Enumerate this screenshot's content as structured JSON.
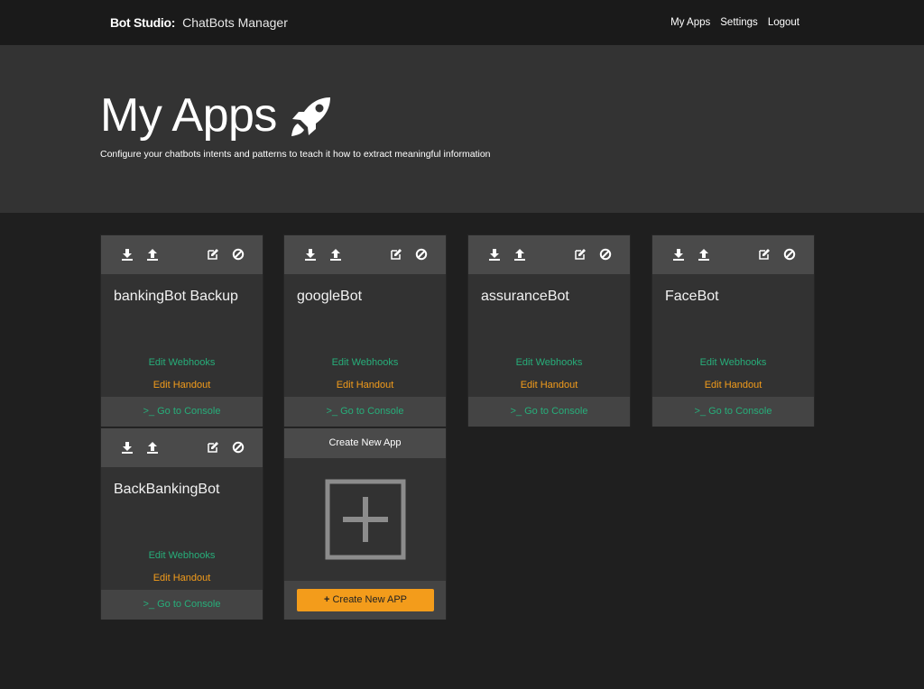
{
  "navbar": {
    "brand": "Bot Studio:",
    "subtitle": "ChatBots Manager",
    "links": [
      "My Apps",
      "Settings",
      "Logout"
    ]
  },
  "hero": {
    "title": "My Apps",
    "subtitle": "Configure your chatbots intents and patterns to teach it how to extract meaningful information",
    "icon": "rocket-icon"
  },
  "card_actions": {
    "download_icon": "download-icon",
    "upload_icon": "upload-icon",
    "edit_icon": "edit-icon",
    "disable_icon": "ban-icon",
    "webhooks": "Edit Webhooks",
    "handout": "Edit Handout",
    "console": ">_ Go to Console"
  },
  "apps": [
    {
      "name": "bankingBot Backup"
    },
    {
      "name": "googleBot"
    },
    {
      "name": "assuranceBot"
    },
    {
      "name": "FaceBot"
    },
    {
      "name": "BackBankingBot"
    }
  ],
  "create_card": {
    "header": "Create New App",
    "button": "Create New APP",
    "icon": "plus-box-icon"
  },
  "colors": {
    "background": "#1f1f1f",
    "navbar": "#1a1a1a",
    "hero": "#333333",
    "card": "#323232",
    "toolbar": "#4a4a4a",
    "green_link": "#27ae7a",
    "orange_link": "#f39c1b",
    "create_button": "#f39c1b"
  }
}
